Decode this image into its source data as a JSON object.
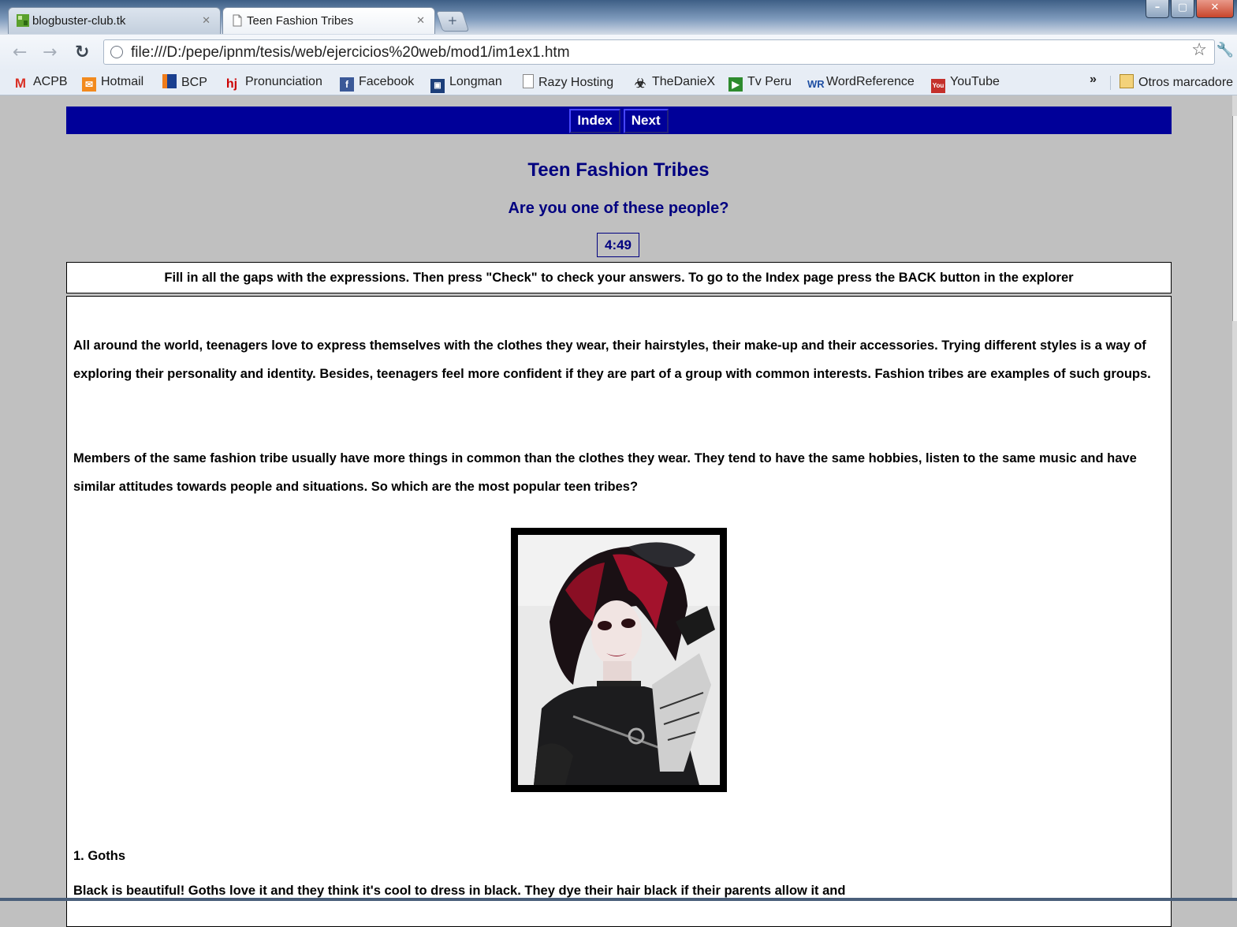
{
  "browser": {
    "tabs": [
      {
        "title": "blogbuster-club.tk",
        "active": false
      },
      {
        "title": "Teen Fashion Tribes",
        "active": true
      }
    ],
    "url": "file:///D:/pepe/ipnm/tesis/web/ejercicios%20web/mod1/im1ex1.htm",
    "bookmarks": [
      "ACPB",
      "Hotmail",
      "BCP",
      "Pronunciation",
      "Facebook",
      "Longman",
      "Razy Hosting",
      "TheDanieX",
      "Tv Peru",
      "WordReference",
      "YouTube"
    ],
    "other_bookmarks": "Otros marcadore"
  },
  "nav": {
    "index_label": "Index",
    "next_label": "Next"
  },
  "page": {
    "title": "Teen Fashion Tribes",
    "subtitle": "Are you one of these people?",
    "timer": "4:49",
    "instructions": "Fill in all the gaps with the expressions. Then press \"Check\" to check your answers. To go to the Index page press the BACK button in the explorer",
    "paragraph1": "All around the world, teenagers love to express themselves with the clothes they wear, their hairstyles, their make-up and their accessories. Trying different styles is a way of exploring their personality and identity. Besides, teenagers feel more confident if they are part of a group with common interests. Fashion tribes are examples of such groups.",
    "paragraph2": "Members of the same fashion tribe usually have more things in common than the clothes they wear. They tend to have the same hobbies, listen to the same music and have similar attitudes towards people and situations. So which are the most popular teen tribes?",
    "section1_heading": "1. Goths",
    "section1_text": "Black is beautiful! Goths love it and they think it's cool to dress in black. They dye their hair black if their parents allow it and"
  },
  "colors": {
    "nav_bar": "#000099",
    "title": "#000080",
    "page_bg": "#c0c0c0"
  }
}
